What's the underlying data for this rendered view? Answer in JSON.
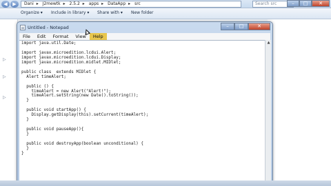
{
  "explorer": {
    "address": [
      "Dani",
      "J2mewtk",
      "2.5.2",
      "apps",
      "DataApp",
      "src"
    ],
    "search_placeholder": "Search src",
    "toolbar": [
      "Organize ▾",
      "Include in library ▾",
      "Share with ▾",
      "New folder"
    ]
  },
  "notepad": {
    "title": "Untitled - Notepad",
    "menu": [
      "File",
      "Edit",
      "Format",
      "View",
      "Help"
    ],
    "active_menu": "Help",
    "lines": [
      "import java.util.Date;",
      "",
      "import javax.microedition.lcdui.Alert;",
      "import javax.microedition.lcdui.Display;",
      "import javax.microedition.midlet.MIDlet;",
      "",
      "public class  extends MIDlet {",
      "  Alert timeAlert;",
      "",
      "  public () {",
      "    timeAlert = new Alert(\"Alert!\");",
      "    timeAlert.setString(new Date().toString());",
      "  }",
      "",
      "  public void startApp() {",
      "    Display.getDisplay(this).setCurrent(timeAlert);",
      "  }",
      "",
      "  public void pauseApp(){",
      "  }",
      "",
      "  public void destroyApp(boolean unconditional) {",
      "  }",
      "}"
    ]
  }
}
